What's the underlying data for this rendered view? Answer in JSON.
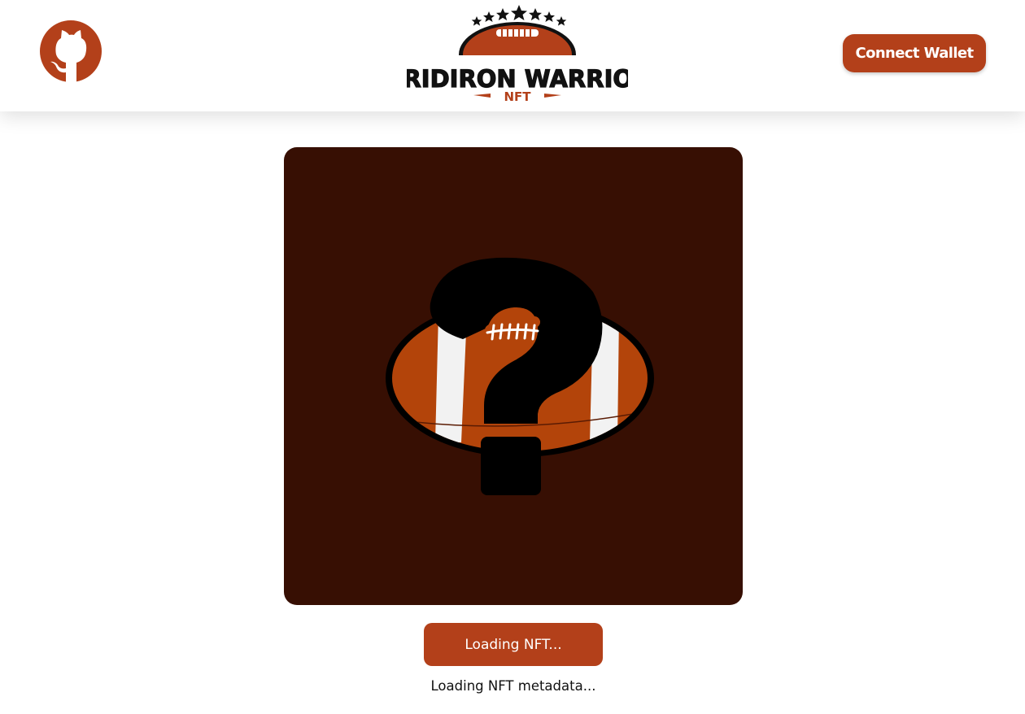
{
  "colors": {
    "accent": "#b3401a",
    "card_background": "#370f03",
    "page_background": "#ffffff",
    "text": "#111111"
  },
  "header": {
    "github_icon": "github-icon",
    "logo": {
      "title": "GRIDIRON WARRIOR",
      "subtitle": "NFT"
    },
    "connect_wallet_label": "Connect Wallet"
  },
  "main": {
    "nft_image_icon": "football-question-mark",
    "action_button_label": "Loading NFT...",
    "status_message": "Loading NFT metadata..."
  }
}
